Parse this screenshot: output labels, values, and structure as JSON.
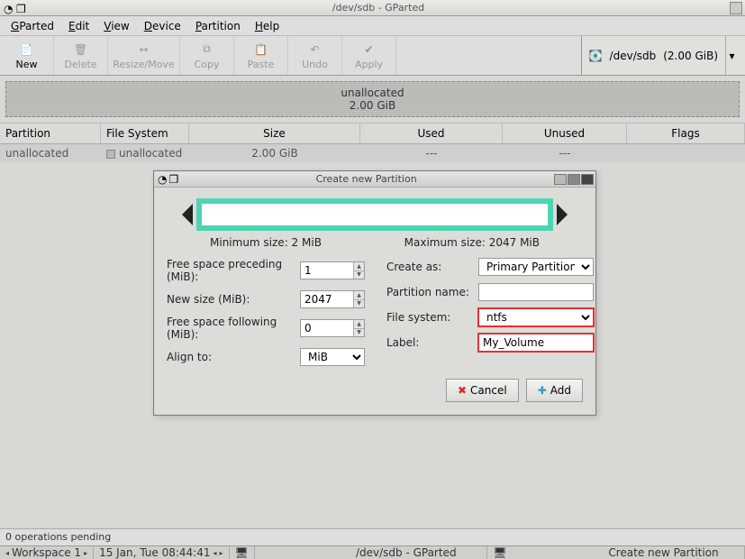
{
  "window": {
    "title": "/dev/sdb - GParted"
  },
  "menubar": [
    "GParted",
    "Edit",
    "View",
    "Device",
    "Partition",
    "Help"
  ],
  "toolbar": {
    "buttons": [
      {
        "name": "new",
        "label": "New",
        "enabled": true
      },
      {
        "name": "delete",
        "label": "Delete",
        "enabled": false
      },
      {
        "name": "resize",
        "label": "Resize/Move",
        "enabled": false
      },
      {
        "name": "copy",
        "label": "Copy",
        "enabled": false
      },
      {
        "name": "paste",
        "label": "Paste",
        "enabled": false
      },
      {
        "name": "undo",
        "label": "Undo",
        "enabled": false
      },
      {
        "name": "apply",
        "label": "Apply",
        "enabled": false
      }
    ],
    "device_selector": {
      "device": "/dev/sdb",
      "size": "(2.00 GiB)"
    }
  },
  "preview": {
    "line1": "unallocated",
    "line2": "2.00 GiB"
  },
  "table": {
    "headers": {
      "partition": "Partition",
      "fs": "File System",
      "size": "Size",
      "used": "Used",
      "unused": "Unused",
      "flags": "Flags"
    },
    "rows": [
      {
        "partition": "unallocated",
        "fs": "unallocated",
        "size": "2.00 GiB",
        "used": "---",
        "unused": "---",
        "flags": ""
      }
    ]
  },
  "dialog": {
    "title": "Create new Partition",
    "min_size": "Minimum size: 2 MiB",
    "max_size": "Maximum size: 2047 MiB",
    "left": {
      "free_preceding": {
        "label": "Free space preceding (MiB):",
        "value": "1"
      },
      "new_size": {
        "label": "New size (MiB):",
        "value": "2047"
      },
      "free_following": {
        "label": "Free space following (MiB):",
        "value": "0"
      },
      "align": {
        "label": "Align to:",
        "value": "MiB"
      }
    },
    "right": {
      "create_as": {
        "label": "Create as:",
        "value": "Primary Partition"
      },
      "partition_name": {
        "label": "Partition name:",
        "value": ""
      },
      "filesystem": {
        "label": "File system:",
        "value": "ntfs"
      },
      "label_field": {
        "label": "Label:",
        "value": "My_Volume"
      }
    },
    "buttons": {
      "cancel": "Cancel",
      "add": "Add"
    }
  },
  "statusbar": "0 operations pending",
  "taskbar": {
    "workspace": "Workspace 1",
    "datetime": "15 Jan, Tue 08:44:41",
    "task1": "/dev/sdb - GParted",
    "task2": "Create new Partition"
  }
}
